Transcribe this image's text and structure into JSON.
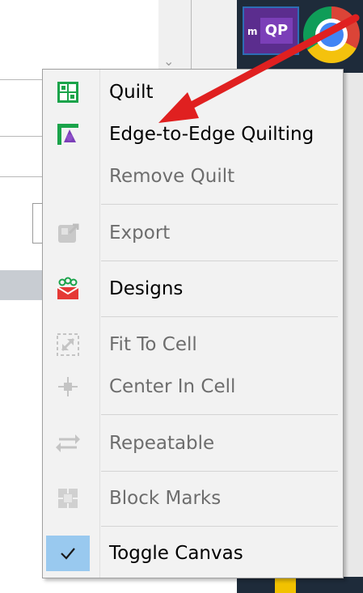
{
  "menu": {
    "items": [
      {
        "label": "Quilt",
        "enabled": true,
        "icon": "quilt-grid-icon"
      },
      {
        "label": "Edge-to-Edge Quilting",
        "enabled": true,
        "icon": "edge-to-edge-icon"
      },
      {
        "label": "Remove Quilt",
        "enabled": false,
        "icon": ""
      },
      {
        "label": "Export",
        "enabled": false,
        "icon": "export-icon"
      },
      {
        "label": "Designs",
        "enabled": true,
        "icon": "designs-icon"
      },
      {
        "label": "Fit To Cell",
        "enabled": false,
        "icon": "fit-to-cell-icon"
      },
      {
        "label": "Center In Cell",
        "enabled": false,
        "icon": "center-in-cell-icon"
      },
      {
        "label": "Repeatable",
        "enabled": false,
        "icon": "repeatable-icon"
      },
      {
        "label": "Block Marks",
        "enabled": false,
        "icon": "block-marks-icon"
      },
      {
        "label": "Toggle Canvas",
        "enabled": true,
        "checked": true,
        "icon": "check-icon"
      }
    ]
  },
  "taskbar": {
    "qp_prefix": "m",
    "qp_label": "QP"
  },
  "colors": {
    "arrow": "#e02020",
    "checked_bg": "#99c9ef",
    "menu_bg": "#f2f2f2",
    "disabled_text": "#6d6d6d"
  }
}
